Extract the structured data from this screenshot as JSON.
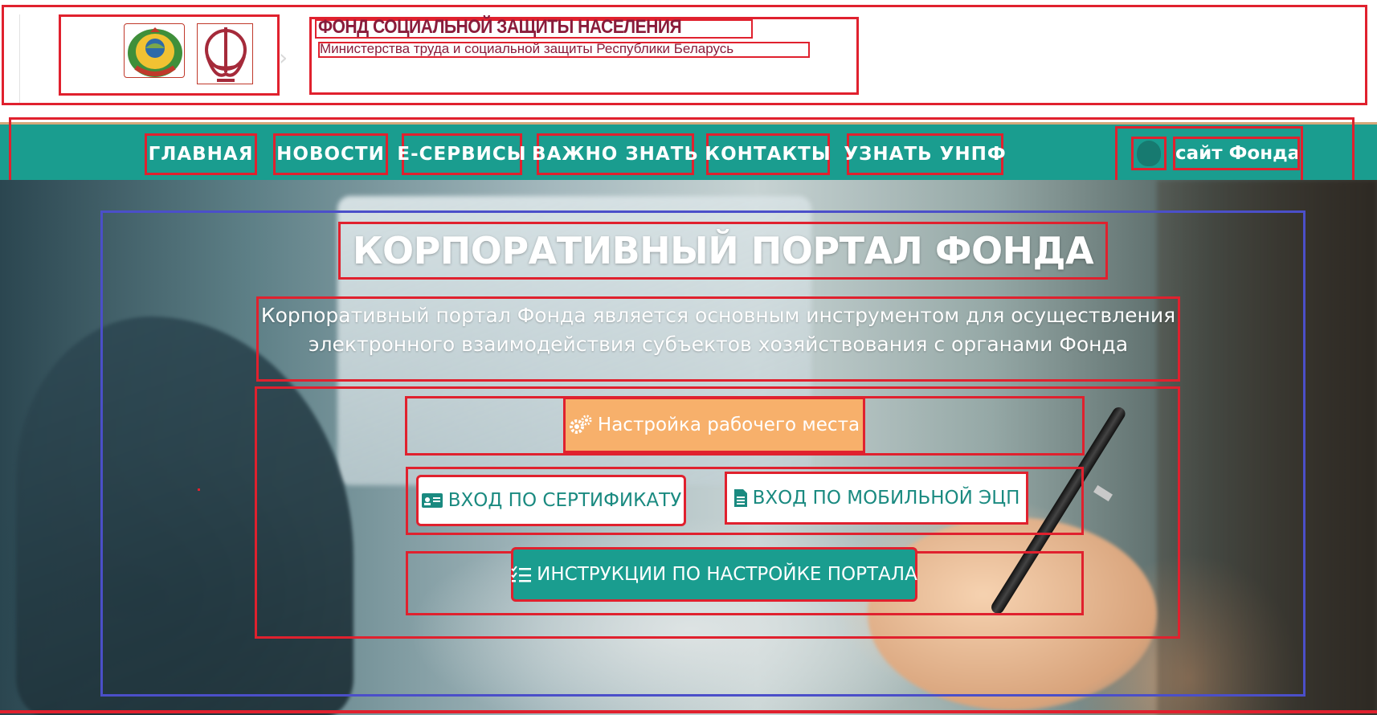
{
  "header": {
    "org_title": "ФОНД СОЦИАЛЬНОЙ ЗАЩИТЫ НАСЕЛЕНИЯ",
    "org_subtitle": "Министерства труда и социальной защиты Республики Беларусь",
    "emblem_icon": "state-emblem-icon",
    "fund_logo_icon": "fund-logo-icon"
  },
  "nav": {
    "items": [
      {
        "label": "ГЛАВНАЯ"
      },
      {
        "label": "НОВОСТИ"
      },
      {
        "label": "Е-СЕРВИСЫ"
      },
      {
        "label": "ВАЖНО ЗНАТЬ"
      },
      {
        "label": "КОНТАКТЫ"
      },
      {
        "label": "УЗНАТЬ УНПФ"
      }
    ],
    "site_link": "сайт Фонда",
    "site_icon": "fund-drop-icon"
  },
  "hero": {
    "title": "КОРПОРАТИВНЫЙ ПОРТАЛ ФОНДА",
    "description": "Корпоративный портал Фонда является основным инструментом для осуществления электронного взаимодействия субъектов хозяйствования с органами Фонда",
    "buttons": {
      "setup": {
        "label": "Настройка рабочего места",
        "icon": "gears-icon"
      },
      "cert": {
        "label": "ВХОД ПО СЕРТИФИКАТУ",
        "icon": "id-card-icon"
      },
      "mobile": {
        "label": "ВХОД ПО МОБИЛЬНОЙ ЭЦП",
        "icon": "document-icon"
      },
      "instructions": {
        "label": "ИНСТРУКЦИИ ПО НАСТРОЙКЕ ПОРТАЛА",
        "icon": "checklist-icon"
      }
    }
  },
  "colors": {
    "teal": "#1a9d8f",
    "orange": "#f7b06b",
    "maroon": "#8a1c3b",
    "annotation_red": "#e0212e",
    "annotation_blue": "#4b4fc9"
  }
}
